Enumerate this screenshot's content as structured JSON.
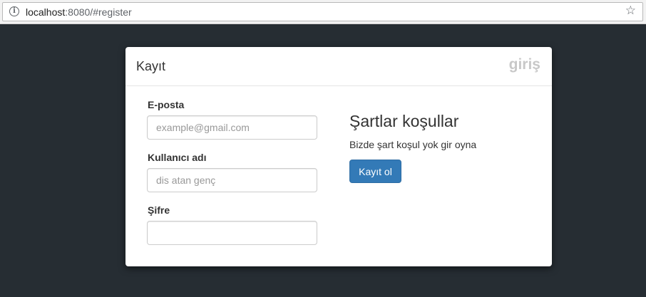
{
  "browser": {
    "url_host": "localhost",
    "url_rest": ":8080/#register",
    "info_icon": "info-icon",
    "bookmark_icon": "star-icon"
  },
  "panel": {
    "title": "Kayıt",
    "login_link": "giriş"
  },
  "form": {
    "email": {
      "label": "E-posta",
      "placeholder": "example@gmail.com",
      "value": ""
    },
    "username": {
      "label": "Kullanıcı adı",
      "placeholder": "dis atan genç",
      "value": ""
    },
    "password": {
      "label": "Şifre",
      "placeholder": "",
      "value": ""
    }
  },
  "terms": {
    "title": "Şartlar koşullar",
    "text": "Bizde şart koşul yok gir oyna",
    "register_label": "Kayıt ol"
  },
  "colors": {
    "page_background": "#262d33",
    "primary_button": "#337ab7",
    "login_link": "#c8c8c8"
  }
}
